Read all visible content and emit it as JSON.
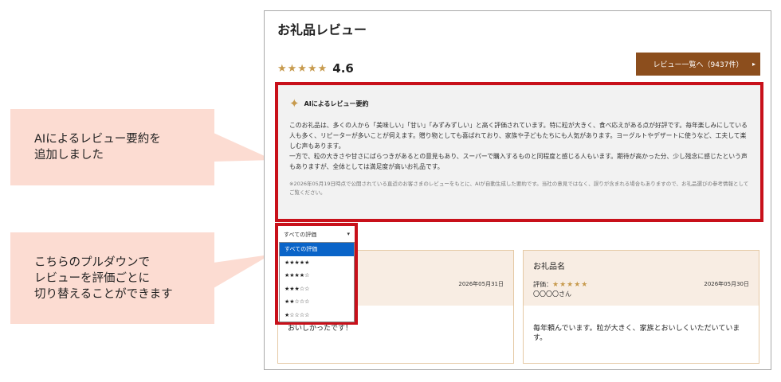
{
  "callouts": {
    "ai_summary_note": "AIによるレビュー要約を\n追加しました",
    "dropdown_note": "こちらのプルダウンで\nレビューを評価ごとに\n切り替えることができます"
  },
  "page": {
    "title": "お礼品レビュー",
    "rating_stars": "★★★★★",
    "rating_value": "4.6",
    "list_button_label": "レビュー一覧へ（9437件）",
    "list_button_caret": "▸"
  },
  "ai_summary": {
    "icon": "sparkle-icon",
    "icon_glyph": "✦",
    "heading": "AIによるレビュー要約",
    "body": "このお礼品は、多くの人から「美味しい」「甘い」「みずみずしい」と高く評価されています。特に粒が大きく、食べ応えがある点が好評です。毎年楽しみにしている人も多く、リピーターが多いことが伺えます。贈り物としても喜ばれており、家族や子どもたちにも人気があります。ヨーグルトやデザートに使うなど、工夫して楽しむ声もあります。\n一方で、粒の大きさや甘さにばらつきがあるとの意見もあり、スーパーで購入するものと同程度と感じる人もいます。期待が高かった分、少し残念に感じたという声もありますが、全体としては満足度が高いお礼品です。",
    "note": "※2026年05月19日時点で公開されている直近のお客さまのレビューをもとに、AIが自動生成した要約です。当社の意見ではなく、誤りが含まれる場合もありますので、お礼品選びの参考情報としてご覧ください。"
  },
  "filter": {
    "selected": "すべての評価",
    "chevron": "▾",
    "options": [
      "すべての評価",
      "★★★★★",
      "★★★★☆",
      "★★★☆☆",
      "★★☆☆☆",
      "★☆☆☆☆"
    ]
  },
  "reviews": [
    {
      "name": "",
      "rating_label": "",
      "stars": "",
      "date": "2026年05月31日",
      "user": "",
      "text": "おいしかったです！"
    },
    {
      "name": "お礼品名",
      "rating_label": "評価：",
      "stars": "★★★★★",
      "date": "2026年05月30日",
      "user": "〇〇〇〇さん",
      "text": "毎年頼んでいます。粒が大きく、家族とおいしくいただいています。"
    }
  ],
  "colors": {
    "accent_red": "#c8101a",
    "button_brown": "#8c4e1d",
    "star_gold": "#c79a4d",
    "callout_pink": "#fcdcd2",
    "card_head": "#f8ede3",
    "select_blue": "#0a64c8"
  }
}
